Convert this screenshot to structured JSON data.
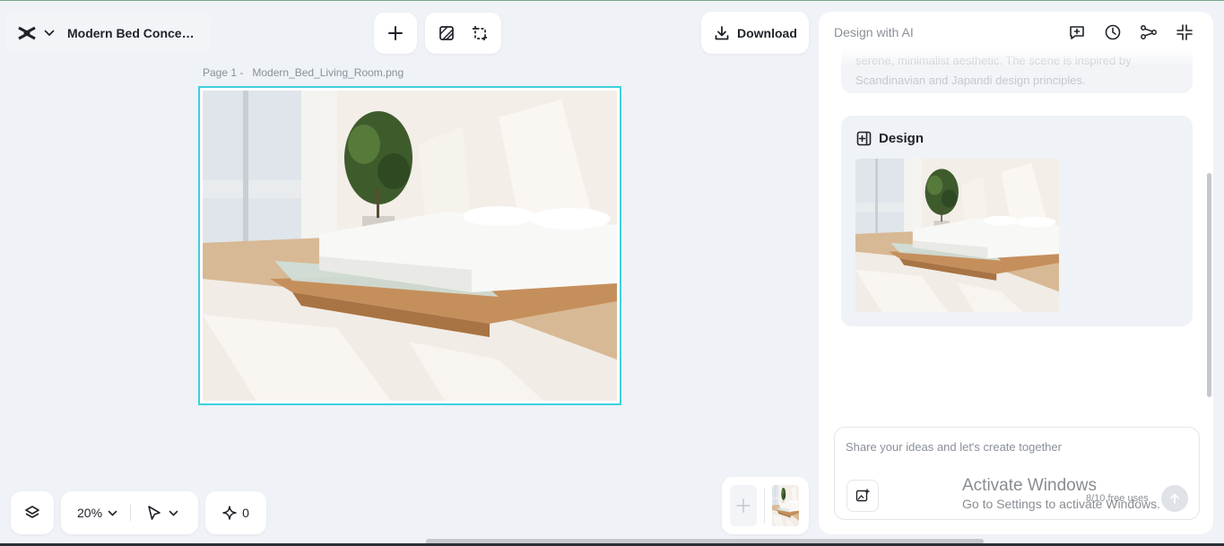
{
  "header": {
    "project_title": "Modern Bed Conce…",
    "download_label": "Download"
  },
  "canvas": {
    "page_label": "Page 1 -",
    "file_name": "Modern_Bed_Living_Room.png"
  },
  "bottom_toolbar": {
    "zoom_level": "20%",
    "credits_count": "0"
  },
  "panel": {
    "title": "Design with AI",
    "previous_message": "serene, minimalist aesthetic. The scene is inspired by Scandinavian and Japandi design principles.",
    "design_section_title": "Design",
    "prompt_placeholder": "Share your ideas and let's create together",
    "free_uses": "8/10 free uses"
  },
  "os_overlay": {
    "activate_title": "Activate Windows",
    "activate_subtitle": "Go to Settings to activate Windows."
  },
  "colors": {
    "canvas_background": "#eff2f6",
    "selection_border": "#3ed0dc",
    "panel_background": "#ffffff"
  }
}
